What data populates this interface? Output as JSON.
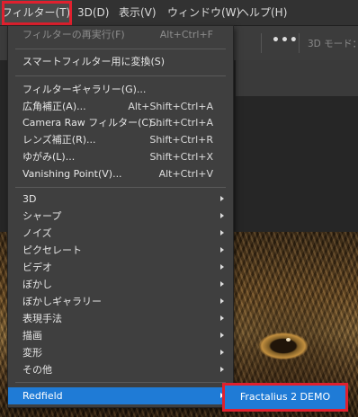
{
  "menubar": {
    "items": [
      {
        "label": "フィルター(T)",
        "active": true
      },
      {
        "label": "3D(D)"
      },
      {
        "label": "表示(V)"
      },
      {
        "label": "ウィンドウ(W)"
      },
      {
        "label": "ヘルプ(H)"
      }
    ]
  },
  "optionsbar": {
    "more_label": "•••",
    "mode_label": "3D モード："
  },
  "filter_menu": {
    "last_filter": {
      "label": "フィルターの再実行(F)",
      "shortcut": "Alt+Ctrl+F",
      "enabled": false
    },
    "smart_filter": {
      "label": "スマートフィルター用に変換(S)"
    },
    "filter_gallery": {
      "label": "フィルターギャラリー(G)..."
    },
    "adaptive_wide_angle": {
      "label": "広角補正(A)...",
      "shortcut": "Alt+Shift+Ctrl+A"
    },
    "camera_raw": {
      "label": "Camera Raw フィルター(C)...",
      "shortcut": "Shift+Ctrl+A"
    },
    "lens_correction": {
      "label": "レンズ補正(R)...",
      "shortcut": "Shift+Ctrl+R"
    },
    "liquify": {
      "label": "ゆがみ(L)...",
      "shortcut": "Shift+Ctrl+X"
    },
    "vanishing_point": {
      "label": "Vanishing Point(V)...",
      "shortcut": "Alt+Ctrl+V"
    },
    "submenus": [
      {
        "label": "3D"
      },
      {
        "label": "シャープ"
      },
      {
        "label": "ノイズ"
      },
      {
        "label": "ピクセレート"
      },
      {
        "label": "ビデオ"
      },
      {
        "label": "ぼかし"
      },
      {
        "label": "ぼかしギャラリー"
      },
      {
        "label": "表現手法"
      },
      {
        "label": "描画"
      },
      {
        "label": "変形"
      },
      {
        "label": "その他"
      }
    ],
    "redfield": {
      "label": "Redfield",
      "highlighted": true
    }
  },
  "redfield_submenu": {
    "items": [
      {
        "label": "Fractalius 2 DEMO"
      }
    ]
  },
  "colors": {
    "highlight": "#1f7bd6",
    "annotation": "#e0202e"
  }
}
